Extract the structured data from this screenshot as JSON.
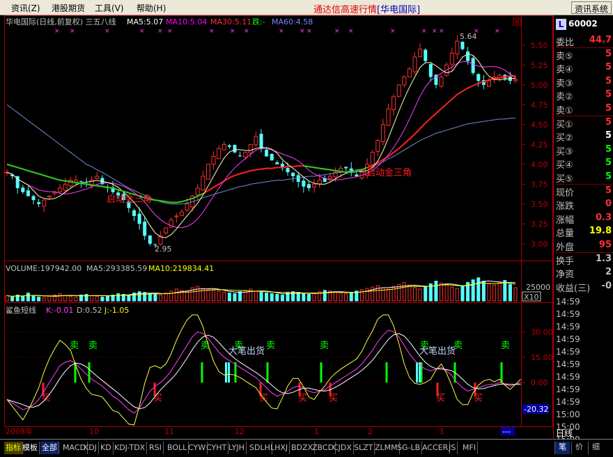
{
  "menubar": {
    "items": [
      "资讯(Z)",
      "港股期货",
      "工具(V)",
      "帮助(H)"
    ],
    "title": "通达信高速行情",
    "title_sub": "[华电国际]",
    "sys_button": "资讯系统"
  },
  "price_panel": {
    "header": "华电国际(日线,前复权) 三五八线",
    "ma5": "MA5:5.07",
    "ma10": "MA10:5.04",
    "ma30": "MA30:5.11",
    "fall": "跌:-",
    "ma60": "MA60:4.58",
    "high_label": "5.64",
    "low_label": "2.95",
    "annot1": "启动金三角",
    "annot2": "启动金三角",
    "yticks": [
      "5.50",
      "5.25",
      "5.00",
      "4.75",
      "4.50",
      "4.25",
      "4.00",
      "3.75",
      "3.50",
      "3.25",
      "3.00"
    ]
  },
  "volume_panel": {
    "header": "VOLUME:197942.00",
    "ma5": "MA5:293385.59",
    "ma10": "MA10:219834.41",
    "ytick": "25000",
    "unit": "X10"
  },
  "osc_panel": {
    "header": "鲨鱼短线",
    "k": "K:-0.01",
    "d": "D:0.52",
    "j": "J:-1.05",
    "yticks": [
      "30.00",
      "15.00",
      "0.00"
    ],
    "current": "-20.32",
    "sell_label": "卖",
    "buy_label": "买",
    "big_sell_label": "大笔出货"
  },
  "xaxis": {
    "labels": [
      "2008年",
      "10",
      "11",
      "12",
      "1",
      "2",
      "3"
    ],
    "right_label": "---"
  },
  "chart_data": {
    "type": "candlestick",
    "price_range": [
      2.85,
      5.7
    ],
    "volume_range": [
      0,
      40000
    ],
    "osc_range": [
      -25,
      40
    ],
    "ohlc_path": [
      3.9,
      3.85,
      3.7,
      3.65,
      3.6,
      3.55,
      3.5,
      3.55,
      3.6,
      3.65,
      3.7,
      3.75,
      3.8,
      3.8,
      3.78,
      3.75,
      3.8,
      3.85,
      3.75,
      3.7,
      3.65,
      3.6,
      3.55,
      3.45,
      3.35,
      3.25,
      3.1,
      3.0,
      2.98,
      3.1,
      3.2,
      3.3,
      3.35,
      3.4,
      3.5,
      3.6,
      3.7,
      3.85,
      4.0,
      4.1,
      4.2,
      4.25,
      4.22,
      4.15,
      4.1,
      4.15,
      4.25,
      4.35,
      4.2,
      4.1,
      4.05,
      4.0,
      3.95,
      3.9,
      3.85,
      3.78,
      3.72,
      3.7,
      3.75,
      3.8,
      3.78,
      3.85,
      3.9,
      3.95,
      3.95,
      3.9,
      3.85,
      3.9,
      4.0,
      4.15,
      4.3,
      4.5,
      4.7,
      4.85,
      5.0,
      5.1,
      5.2,
      5.35,
      5.45,
      5.3,
      5.1,
      5.0,
      5.1,
      5.25,
      5.4,
      5.55,
      5.45,
      5.3,
      5.15,
      5.05,
      5.0,
      5.05,
      5.1,
      5.12,
      5.08,
      5.05,
      5.07
    ],
    "ma60_path": [
      4.75,
      4.7,
      4.65,
      4.6,
      4.55,
      4.5,
      4.45,
      4.4,
      4.35,
      4.3,
      4.25,
      4.2,
      4.15,
      4.1,
      4.05,
      4.0,
      3.97,
      3.93,
      3.9,
      3.86,
      3.82,
      3.78,
      3.74,
      3.7,
      3.67,
      3.64,
      3.61,
      3.58,
      3.55,
      3.53,
      3.51,
      3.5,
      3.5,
      3.5,
      3.51,
      3.53,
      3.55,
      3.58,
      3.6,
      3.62,
      3.64,
      3.66,
      3.68,
      3.7,
      3.72,
      3.73,
      3.75,
      3.76,
      3.77,
      3.78,
      3.79,
      3.8,
      3.8,
      3.81,
      3.82,
      3.83,
      3.84,
      3.85,
      3.85,
      3.86,
      3.87,
      3.88,
      3.89,
      3.9,
      3.91,
      3.92,
      3.93,
      3.94,
      3.96,
      3.98,
      4.0,
      4.03,
      4.07,
      4.1,
      4.14,
      4.18,
      4.22,
      4.26,
      4.3,
      4.33,
      4.36,
      4.39,
      4.41,
      4.43,
      4.45,
      4.47,
      4.49,
      4.51,
      4.52,
      4.53,
      4.54,
      4.55,
      4.56,
      4.57,
      4.57,
      4.58,
      4.58
    ],
    "ma30_path": [
      4.0,
      3.98,
      3.96,
      3.94,
      3.92,
      3.9,
      3.88,
      3.86,
      3.84,
      3.82,
      3.8,
      3.79,
      3.78,
      3.77,
      3.76,
      3.75,
      3.74,
      3.73,
      3.72,
      3.71,
      3.7,
      3.68,
      3.66,
      3.64,
      3.62,
      3.6,
      3.58,
      3.56,
      3.55,
      3.54,
      3.53,
      3.52,
      3.52,
      3.53,
      3.55,
      3.57,
      3.6,
      3.63,
      3.67,
      3.71,
      3.75,
      3.79,
      3.83,
      3.86,
      3.88,
      3.9,
      3.92,
      3.93,
      3.94,
      3.95,
      3.95,
      3.96,
      3.96,
      3.97,
      3.97,
      3.98,
      3.98,
      3.97,
      3.96,
      3.95,
      3.94,
      3.93,
      3.92,
      3.91,
      3.9,
      3.9,
      3.91,
      3.93,
      3.96,
      3.99,
      4.02,
      4.06,
      4.1,
      4.15,
      4.2,
      4.26,
      4.32,
      4.38,
      4.45,
      4.52,
      4.58,
      4.64,
      4.7,
      4.76,
      4.82,
      4.88,
      4.92,
      4.96,
      4.99,
      5.02,
      5.04,
      5.06,
      5.08,
      5.09,
      5.1,
      5.11,
      5.11
    ],
    "vol_values": [
      8000,
      6000,
      9000,
      7000,
      12000,
      8000,
      6000,
      5000,
      7000,
      9000,
      11000,
      8000,
      7000,
      6000,
      9000,
      10000,
      8000,
      7000,
      6000,
      8000,
      9000,
      11000,
      10000,
      9000,
      12000,
      14000,
      13000,
      11000,
      10000,
      9000,
      12000,
      15000,
      18000,
      16000,
      14000,
      20000,
      22000,
      19000,
      17000,
      16000,
      15000,
      13000,
      12000,
      11000,
      14000,
      16000,
      18000,
      15000,
      13000,
      12000,
      11000,
      10000,
      9000,
      12000,
      14000,
      13000,
      11000,
      10000,
      12000,
      14000,
      16000,
      15000,
      13000,
      12000,
      11000,
      13000,
      15000,
      17000,
      19000,
      21000,
      23000,
      20000,
      18000,
      22000,
      25000,
      28000,
      24000,
      20000,
      18000,
      22000,
      26000,
      30000,
      27000,
      24000,
      21000,
      19000,
      23000,
      28000,
      32000,
      35000,
      30000,
      26000,
      24000,
      28000,
      31000,
      25000,
      20000
    ],
    "k_path": [
      -10,
      -12,
      -14,
      -16,
      -15,
      -13,
      -10,
      -5,
      0,
      5,
      10,
      12,
      13,
      11,
      8,
      5,
      2,
      0,
      -2,
      -5,
      -8,
      -10,
      -13,
      -16,
      -18,
      -15,
      -10,
      -5,
      -2,
      0,
      3,
      7,
      12,
      17,
      22,
      27,
      30,
      29,
      26,
      22,
      18,
      15,
      13,
      11,
      9,
      7,
      5,
      3,
      0,
      -3,
      -6,
      -8,
      -7,
      -5,
      -3,
      -2,
      -3,
      -5,
      -6,
      -5,
      -4,
      -2,
      0,
      2,
      4,
      6,
      8,
      11,
      15,
      19,
      24,
      28,
      31,
      30,
      27,
      22,
      17,
      13,
      10,
      8,
      7,
      8,
      9,
      7,
      4,
      0,
      -3,
      -5,
      -4,
      -3,
      -2,
      -1,
      -1,
      0,
      -1,
      -2,
      -1,
      0
    ]
  },
  "quote": {
    "code": "60002",
    "code_label": "L",
    "rows": [
      {
        "label": "委比",
        "value": "44.7",
        "color": "#ff3030"
      },
      {
        "label": "卖⑤",
        "value": "5",
        "color": "#ff3030"
      },
      {
        "label": "卖④",
        "value": "5",
        "color": "#ff3030"
      },
      {
        "label": "卖③",
        "value": "5",
        "color": "#ff3030"
      },
      {
        "label": "卖②",
        "value": "5",
        "color": "#ff3030"
      },
      {
        "label": "卖①",
        "value": "5",
        "color": "#ff3030"
      },
      {
        "label": "买①",
        "value": "5",
        "color": "#ff3030"
      },
      {
        "label": "买②",
        "value": "5",
        "color": "#ffffff"
      },
      {
        "label": "买③",
        "value": "5",
        "color": "#00ff00"
      },
      {
        "label": "买④",
        "value": "5",
        "color": "#00ff00"
      },
      {
        "label": "买⑤",
        "value": "5",
        "color": "#00ff00"
      },
      {
        "label": "现价",
        "value": "5",
        "color": "#ff3030"
      },
      {
        "label": "涨跌",
        "value": "0",
        "color": "#ff3030"
      },
      {
        "label": "涨幅",
        "value": "0.3",
        "color": "#ff3030"
      },
      {
        "label": "总量",
        "value": "19.8",
        "color": "#ffff00"
      },
      {
        "label": "外盘",
        "value": "95",
        "color": "#ff3030"
      },
      {
        "label": "换手",
        "value": "1.3",
        "color": "#c0c0c0"
      },
      {
        "label": "净资",
        "value": "2",
        "color": "#c0c0c0"
      },
      {
        "label": "收益(三)",
        "value": "-0",
        "color": "#c0c0c0"
      }
    ],
    "times": [
      "14:59",
      "14:59",
      "14:59",
      "14:59",
      "14:59",
      "14:59",
      "14:59",
      "14:59",
      "14:59",
      "15:00",
      "15:00",
      "15:00"
    ],
    "day_label": "日线"
  },
  "bottom": {
    "tabs": [
      "指标",
      "模板",
      "全部",
      "MACD",
      "KDJ",
      "KD",
      "KDJ-TDX",
      "RSI",
      "BOLL",
      "CYW",
      "CYHT",
      "LYJH",
      "SDLH",
      "LHXJ",
      "BDZX",
      "ZBCD",
      "CJDX",
      "SLZT",
      "ZLMM",
      "SG-LB",
      "ACCER",
      "JS",
      "MFI"
    ],
    "right_tabs": [
      "笔",
      "价",
      "细"
    ]
  }
}
